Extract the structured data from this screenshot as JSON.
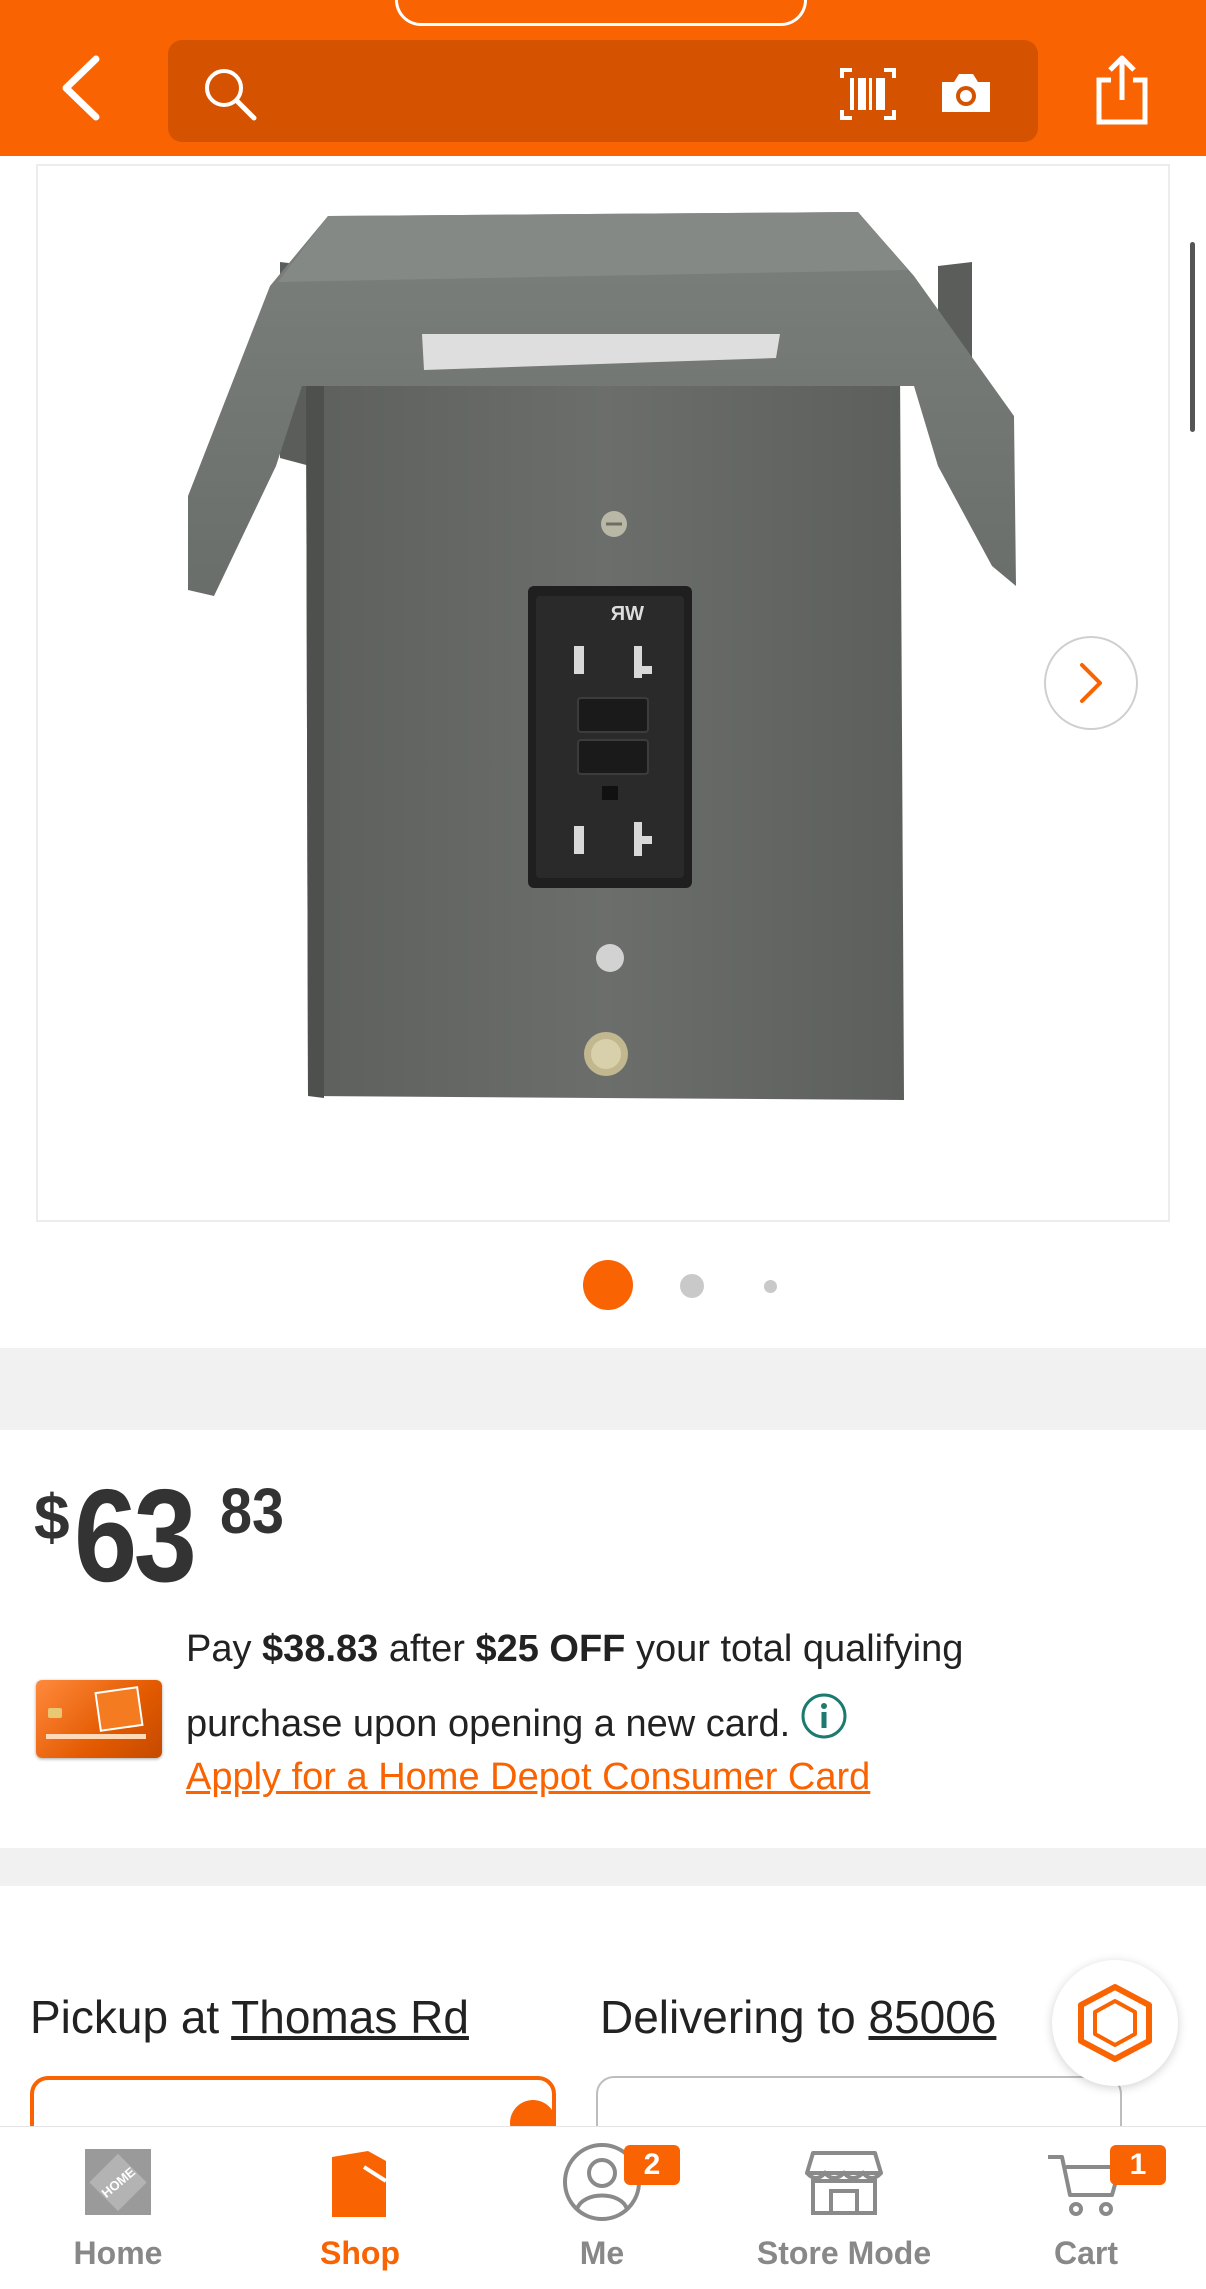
{
  "colors": {
    "brand": "#f96302",
    "brand_dark": "#d55300",
    "text": "#222222",
    "muted": "#888888"
  },
  "header": {
    "search": {
      "value": "",
      "placeholder": ""
    },
    "icons": [
      "back-icon",
      "search-icon",
      "barcode-icon",
      "camera-icon",
      "share-icon"
    ]
  },
  "gallery": {
    "image_alt": "Weatherproof GFCI outlet box",
    "image_count": 3,
    "active_index": 0
  },
  "price": {
    "currency": "$",
    "dollars": "63",
    "cents": "83"
  },
  "promo": {
    "pay_text": "Pay",
    "pay_amount": "$38.83",
    "after_text": "after",
    "off_amount": "$25 OFF",
    "rest_line1": "your total qualifying",
    "line2": "purchase upon opening a new card.",
    "apply_link": "Apply for a Home Depot Consumer Card"
  },
  "fulfillment": {
    "pickup_prefix": "Pickup at",
    "pickup_store": "Thomas Rd",
    "delivery_prefix": "Delivering to",
    "delivery_zip": "85006"
  },
  "bottom_nav": {
    "items": [
      {
        "label": "Home",
        "icon": "home-depot-logo-icon",
        "active": false
      },
      {
        "label": "Shop",
        "icon": "shop-icon",
        "active": true
      },
      {
        "label": "Me",
        "icon": "user-icon",
        "active": false,
        "badge": "2"
      },
      {
        "label": "Store Mode",
        "icon": "store-icon",
        "active": false
      },
      {
        "label": "Cart",
        "icon": "cart-icon",
        "active": false,
        "badge": "1"
      }
    ]
  }
}
